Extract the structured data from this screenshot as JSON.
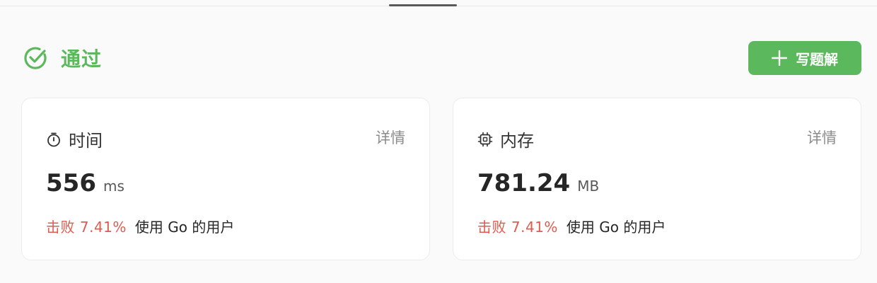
{
  "status": {
    "label": "通过",
    "color": "#5cb85c",
    "icon": "check-circle-icon"
  },
  "actions": {
    "write_solution_label": "写题解",
    "write_solution_icon": "plus-icon",
    "accent": "#5cb85c"
  },
  "cards": {
    "time": {
      "title": "时间",
      "icon": "stopwatch-icon",
      "details_label": "详情",
      "value": "556",
      "unit": "ms",
      "beats_label": "击败 7.41%",
      "beats_suffix": "使用 Go 的用户"
    },
    "memory": {
      "title": "内存",
      "icon": "chip-icon",
      "details_label": "详情",
      "value": "781.24",
      "unit": "MB",
      "beats_label": "击败 7.41%",
      "beats_suffix": "使用 Go 的用户"
    }
  },
  "colors": {
    "beats": "#e05a4e",
    "details": "#8c8c8c"
  }
}
